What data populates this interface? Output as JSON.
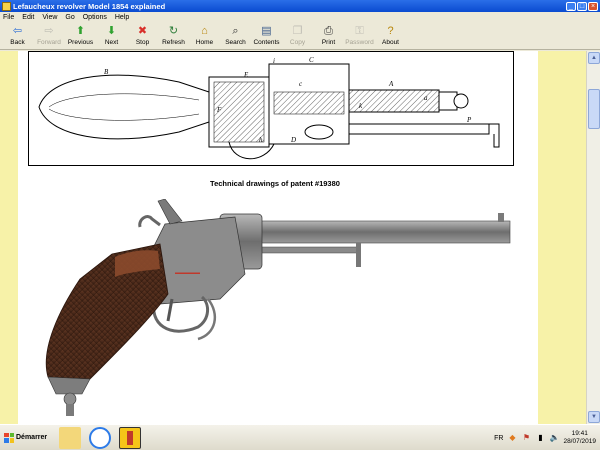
{
  "window": {
    "title": "Lefaucheux revolver Model 1854 explained"
  },
  "menu": [
    "File",
    "Edit",
    "View",
    "Go",
    "Options",
    "Help"
  ],
  "toolbar": [
    {
      "label": "Back",
      "icon": "back-arrow-icon",
      "glyph": "⇦",
      "color": "#2e6fd6",
      "enabled": true
    },
    {
      "label": "Forward",
      "icon": "forward-arrow-icon",
      "glyph": "⇨",
      "color": "#8a8a8a",
      "enabled": false
    },
    {
      "label": "Previous",
      "icon": "up-arrow-icon",
      "glyph": "⬆",
      "color": "#2fa22f",
      "enabled": true
    },
    {
      "label": "Next",
      "icon": "down-arrow-icon",
      "glyph": "⬇",
      "color": "#2fa22f",
      "enabled": true
    },
    {
      "label": "Stop",
      "icon": "stop-icon",
      "glyph": "✖",
      "color": "#d8302a",
      "enabled": true
    },
    {
      "label": "Refresh",
      "icon": "refresh-icon",
      "glyph": "↻",
      "color": "#2e7d3a",
      "enabled": true
    },
    {
      "label": "Home",
      "icon": "home-icon",
      "glyph": "⌂",
      "color": "#b8860b",
      "enabled": true
    },
    {
      "label": "Search",
      "icon": "search-icon",
      "glyph": "⌕",
      "color": "#333333",
      "enabled": true
    },
    {
      "label": "Contents",
      "icon": "contents-icon",
      "glyph": "▤",
      "color": "#3a5a8a",
      "enabled": true
    },
    {
      "label": "Copy",
      "icon": "copy-icon",
      "glyph": "❐",
      "color": "#8a8a8a",
      "enabled": false
    },
    {
      "label": "Print",
      "icon": "print-icon",
      "glyph": "⎙",
      "color": "#333333",
      "enabled": true
    },
    {
      "label": "Password",
      "icon": "password-icon",
      "glyph": "⚿",
      "color": "#8a8a8a",
      "enabled": false
    },
    {
      "label": "About",
      "icon": "about-icon",
      "glyph": "?",
      "color": "#b8860b",
      "enabled": true
    }
  ],
  "content": {
    "caption": "Technical drawings of patent #19380",
    "drawing_letters": [
      "B",
      "E",
      "C",
      "A",
      "F",
      "c",
      "a",
      "k",
      "h",
      "D",
      "P",
      "i"
    ]
  },
  "taskbar": {
    "start_label": "Démarrer",
    "lang": "FR",
    "time": "19:41",
    "date": "28/07/2019"
  },
  "colors": {
    "margin": "#f7f2a8",
    "titlebar": "#0a4bd0"
  }
}
